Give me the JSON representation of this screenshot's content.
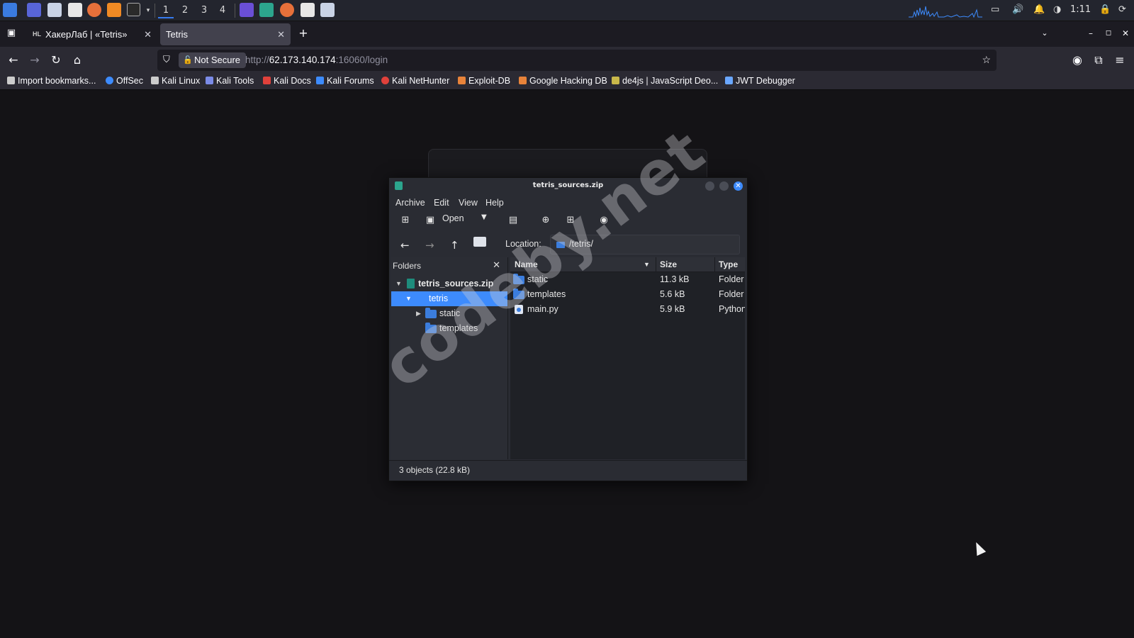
{
  "panel": {
    "workspaces": [
      "1",
      "2",
      "3",
      "4"
    ],
    "clock": "1:11",
    "launchers": [
      "kali-menu-icon",
      "workspace-icon",
      "file-manager-icon",
      "text-editor-icon",
      "firefox-icon",
      "burp-icon",
      "terminal-icon"
    ],
    "tray_icons": [
      "network-icon",
      "volume-icon",
      "notification-bell-icon",
      "battery-icon",
      "lock-icon",
      "power-icon"
    ]
  },
  "browser": {
    "tabs": [
      {
        "favicon": "HL",
        "label": "ХакерЛаб | «Tetris»"
      },
      {
        "label": "Tetris"
      }
    ],
    "security_label": "Not Secure",
    "url": {
      "prefix": "http://",
      "host": "62.173.140.174",
      "rest": ":16060/login"
    },
    "bookmarks": [
      {
        "label": "Import bookmarks...",
        "color": "#cccccc"
      },
      {
        "label": "OffSec",
        "color": "#3d8bfd"
      },
      {
        "label": "Kali Linux",
        "color": "#cccccc"
      },
      {
        "label": "Kali Tools",
        "color": "#7b8be8"
      },
      {
        "label": "Kali Docs",
        "color": "#e0413b"
      },
      {
        "label": "Kali Forums",
        "color": "#3d8bfd"
      },
      {
        "label": "Kali NetHunter",
        "color": "#e0413b"
      },
      {
        "label": "Exploit-DB",
        "color": "#e8833a"
      },
      {
        "label": "Google Hacking DB",
        "color": "#e8833a"
      },
      {
        "label": "de4js | JavaScript Deo...",
        "color": "#c9b84a"
      },
      {
        "label": "JWT Debugger",
        "color": "#6aa7ff"
      }
    ]
  },
  "archive": {
    "title": "tetris_sources.zip",
    "menu": [
      "Archive",
      "Edit",
      "View",
      "Help"
    ],
    "toolbar": {
      "open_label": "Open"
    },
    "location_label": "Location:",
    "location_value": "/tetris/",
    "folders_header": "Folders",
    "tree": [
      {
        "label": "tetris_sources.zip",
        "level": 0,
        "expanded": true,
        "bold": true,
        "icon": "zip"
      },
      {
        "label": "tetris",
        "level": 1,
        "expanded": true,
        "selected": true,
        "icon": "none"
      },
      {
        "label": "static",
        "level": 2,
        "expanded": false,
        "icon": "folder"
      },
      {
        "label": "templates",
        "level": 2,
        "icon": "folder"
      }
    ],
    "columns": {
      "name": "Name",
      "size": "Size",
      "type": "Type"
    },
    "files": [
      {
        "name": "static",
        "size": "11.3 kB",
        "type": "Folder",
        "icon": "folder"
      },
      {
        "name": "templates",
        "size": "5.6 kB",
        "type": "Folder",
        "icon": "folder"
      },
      {
        "name": "main.py",
        "size": "5.9 kB",
        "type": "Python",
        "icon": "python"
      }
    ],
    "status": "3 objects (22.8 kB)"
  },
  "watermark": "codeby.net",
  "colors": {
    "accent": "#3d8bfd",
    "folder": "#3b7ddd"
  }
}
